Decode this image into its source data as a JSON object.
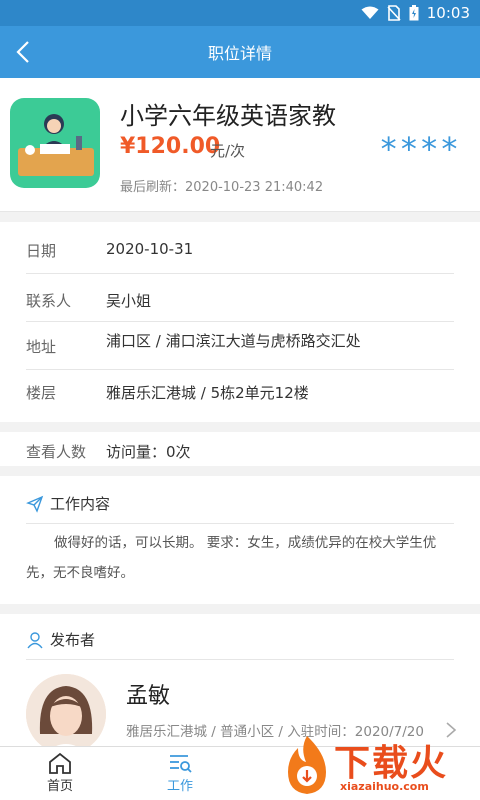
{
  "status_bar": {
    "time": "10:03"
  },
  "header": {
    "title": "职位详情"
  },
  "job": {
    "title": "小学六年级英语家教",
    "price": "¥120.00",
    "price_unit": "元/次",
    "stars": "****",
    "last_refresh_label": "最后刷新：",
    "last_refresh_value": "2020-10-23 21:40:42"
  },
  "details": [
    {
      "label": "日期",
      "value": "2020-10-31"
    },
    {
      "label": "联系人",
      "value": "吴小姐"
    },
    {
      "label": "地址",
      "value": "浦口区 / 浦口滨江大道与虎桥路交汇处"
    },
    {
      "label": "楼层",
      "value": "雅居乐汇港城 / 5栋2单元12楼"
    }
  ],
  "views": {
    "label": "查看人数",
    "value": "访问量：0次"
  },
  "work": {
    "heading": "工作内容",
    "description": "做得好的话，可以长期。 要求：女生，成绩优异的在校大学生优先，无不良嗜好。"
  },
  "publisher": {
    "heading": "发布者",
    "name": "孟敏",
    "meta": "雅居乐汇港城 / 普通小区 / 入驻时间：2020/7/20"
  },
  "tabs": [
    {
      "label": "首页",
      "icon": "home-icon",
      "active": false
    },
    {
      "label": "工作",
      "icon": "job-list-icon",
      "active": true
    }
  ],
  "watermark": {
    "text": "下载火",
    "url": "xiazaihuo.com"
  },
  "colors": {
    "primary": "#3b98dc",
    "price": "#f05a28",
    "logo_bg": "#3ccb96"
  }
}
